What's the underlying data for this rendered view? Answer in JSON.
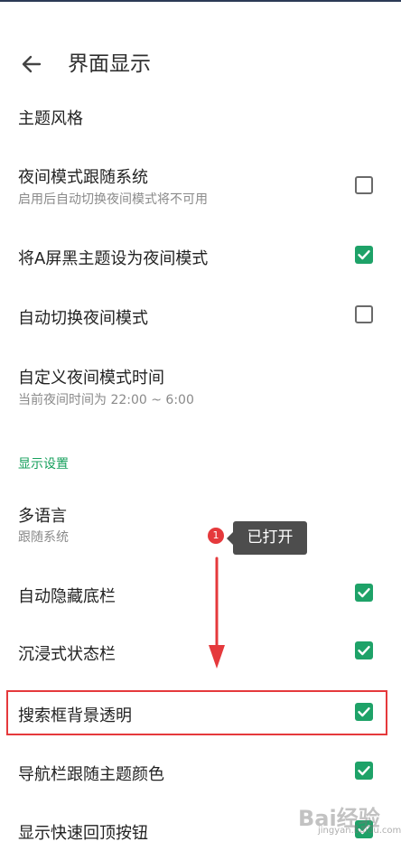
{
  "header": {
    "title": "界面显示"
  },
  "items": [
    {
      "label": "主题风格"
    },
    {
      "label": "夜间模式跟随系统",
      "subtitle": "启用后自动切换夜间模式将不可用",
      "checked": false
    },
    {
      "label": "将A屏黑主题设为夜间模式",
      "checked": true
    },
    {
      "label": "自动切换夜间模式",
      "checked": false
    },
    {
      "label": "自定义夜间模式时间",
      "subtitle": "当前夜间时间为 22:00 ~ 6:00"
    }
  ],
  "section": {
    "title": "显示设置"
  },
  "display_items": [
    {
      "label": "多语言",
      "subtitle": "跟随系统"
    },
    {
      "label": "自动隐藏底栏",
      "checked": true
    },
    {
      "label": "沉浸式状态栏",
      "checked": true
    },
    {
      "label": "搜索框背景透明",
      "checked": true
    },
    {
      "label": "导航栏跟随主题颜色",
      "checked": true
    },
    {
      "label": "显示快速回顶按钮",
      "checked": true
    }
  ],
  "annotation": {
    "badge_number": "1",
    "tooltip": "已打开"
  },
  "watermark": {
    "text": "Bai经验",
    "url": "jingyan.baidu.com"
  },
  "colors": {
    "accent": "#1ea268",
    "section": "#17a05d",
    "highlight": "#e5393c",
    "tooltip_bg": "#4d4d4d"
  }
}
